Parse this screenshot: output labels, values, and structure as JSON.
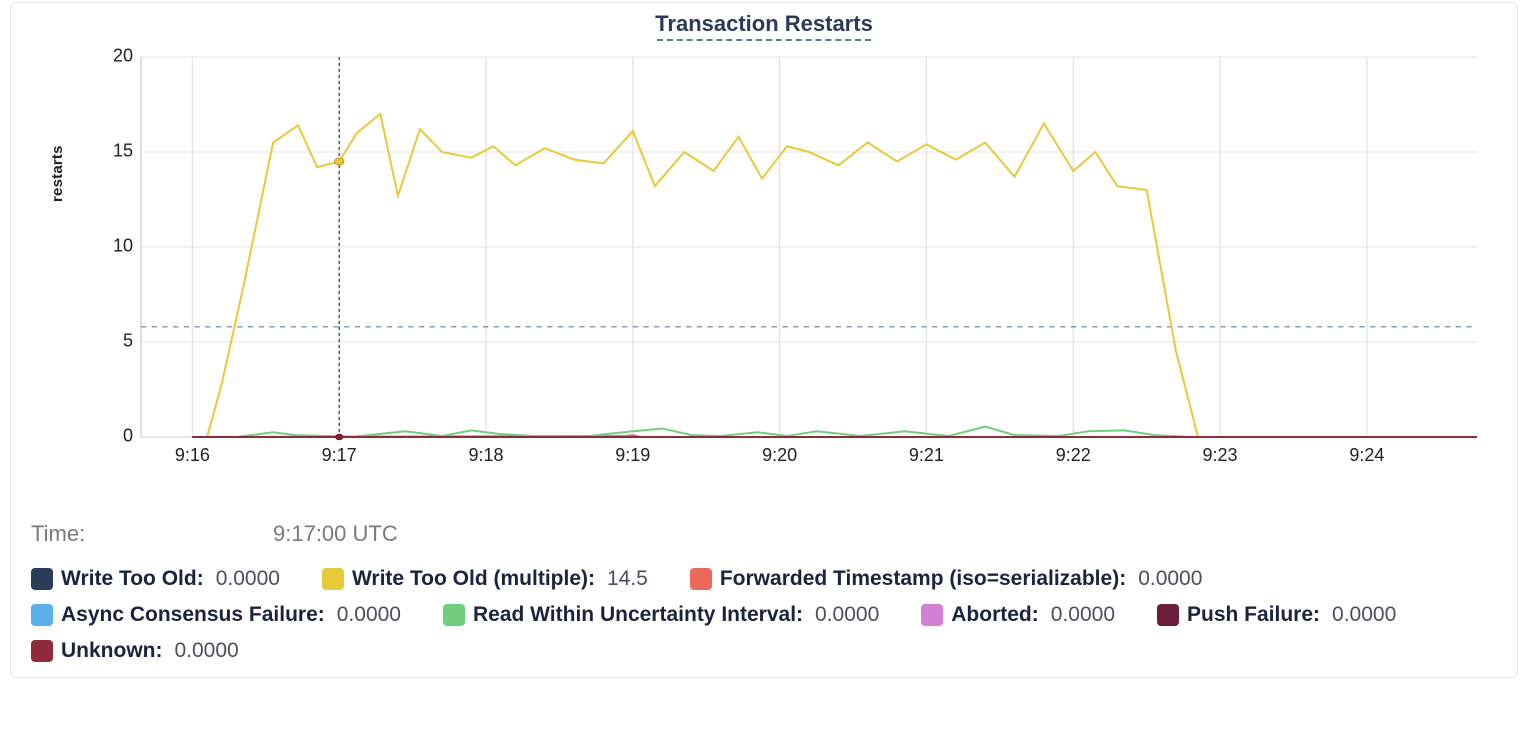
{
  "chart_data": {
    "type": "line",
    "title": "Transaction Restarts",
    "xlabel": "",
    "ylabel": "restarts",
    "ylim": [
      0,
      20
    ],
    "yticks": [
      0,
      5,
      10,
      15,
      20
    ],
    "xlim_minutes": [
      15.65,
      24.75
    ],
    "x_tick_labels": [
      "9:16",
      "9:17",
      "9:18",
      "9:19",
      "9:20",
      "9:21",
      "9:22",
      "9:23",
      "9:24"
    ],
    "x_tick_minutes": [
      16,
      17,
      18,
      19,
      20,
      21,
      22,
      23,
      24
    ],
    "reference_line": 5.8,
    "cursor_minute": 17.0,
    "series": [
      {
        "name": "Write Too Old",
        "color": "#2a3c59",
        "x": [
          16.0,
          16.1,
          16.2,
          16.3,
          20.0,
          24.75
        ],
        "y": [
          0,
          0,
          0,
          0,
          0,
          0
        ]
      },
      {
        "name": "Write Too Old (multiple)",
        "color": "#e7c93a",
        "x": [
          16.1,
          16.2,
          16.35,
          16.55,
          16.72,
          16.85,
          17.0,
          17.12,
          17.28,
          17.4,
          17.55,
          17.7,
          17.9,
          18.05,
          18.2,
          18.4,
          18.6,
          18.8,
          19.0,
          19.15,
          19.35,
          19.55,
          19.72,
          19.88,
          20.05,
          20.2,
          20.4,
          20.6,
          20.8,
          21.0,
          21.2,
          21.4,
          21.6,
          21.8,
          22.0,
          22.15,
          22.3,
          22.5,
          22.7,
          22.85
        ],
        "y": [
          0.0,
          2.8,
          8.0,
          15.5,
          16.4,
          14.2,
          14.5,
          16.0,
          17.0,
          12.7,
          16.2,
          15.0,
          14.7,
          15.3,
          14.3,
          15.2,
          14.6,
          14.4,
          16.1,
          13.2,
          15.0,
          14.0,
          15.8,
          13.6,
          15.3,
          15.0,
          14.3,
          15.5,
          14.5,
          15.4,
          14.6,
          15.5,
          13.7,
          16.5,
          14.0,
          15.0,
          13.2,
          13.0,
          4.5,
          0.0
        ]
      },
      {
        "name": "Forwarded Timestamp (iso=serializable)",
        "color": "#ed6a5a",
        "x": [
          16.0,
          18.95,
          19.0,
          19.05,
          24.75
        ],
        "y": [
          0,
          0.05,
          0.1,
          0,
          0
        ]
      },
      {
        "name": "Async Consensus Failure",
        "color": "#5ab0e8",
        "x": [
          16.0,
          24.75
        ],
        "y": [
          0,
          0
        ]
      },
      {
        "name": "Read Within Uncertainty Interval",
        "color": "#6fcf7f",
        "x": [
          16.3,
          16.55,
          16.7,
          16.9,
          17.1,
          17.45,
          17.7,
          17.9,
          18.1,
          18.4,
          18.7,
          19.0,
          19.2,
          19.4,
          19.6,
          19.85,
          20.05,
          20.25,
          20.55,
          20.85,
          21.15,
          21.4,
          21.6,
          21.9,
          22.1,
          22.35,
          22.55,
          22.8
        ],
        "y": [
          0.0,
          0.25,
          0.1,
          0.05,
          0.02,
          0.3,
          0.05,
          0.35,
          0.15,
          0.02,
          0.05,
          0.3,
          0.45,
          0.1,
          0.05,
          0.25,
          0.05,
          0.3,
          0.05,
          0.3,
          0.05,
          0.55,
          0.1,
          0.05,
          0.3,
          0.35,
          0.1,
          0.0
        ]
      },
      {
        "name": "Aborted",
        "color": "#d37fd3",
        "x": [
          16.0,
          24.75
        ],
        "y": [
          0,
          0
        ]
      },
      {
        "name": "Push Failure",
        "color": "#6b1f3a",
        "x": [
          16.0,
          24.75
        ],
        "y": [
          0,
          0
        ]
      },
      {
        "name": "Unknown",
        "color": "#8f2b3a",
        "x": [
          16.0,
          24.75
        ],
        "y": [
          0,
          0
        ]
      }
    ]
  },
  "tooltip": {
    "time_label": "Time:",
    "time_value": "9:17:00 UTC",
    "items": [
      {
        "name": "Write Too Old",
        "value": "0.0000",
        "color": "#2a3c59"
      },
      {
        "name": "Write Too Old (multiple)",
        "value": "14.5",
        "color": "#e7c93a"
      },
      {
        "name": "Forwarded Timestamp (iso=serializable)",
        "value": "0.0000",
        "color": "#ed6a5a"
      },
      {
        "name": "Async Consensus Failure",
        "value": "0.0000",
        "color": "#5ab0e8"
      },
      {
        "name": "Read Within Uncertainty Interval",
        "value": "0.0000",
        "color": "#6fcf7f"
      },
      {
        "name": "Aborted",
        "value": "0.0000",
        "color": "#d37fd3"
      },
      {
        "name": "Push Failure",
        "value": "0.0000",
        "color": "#6b1f3a"
      },
      {
        "name": "Unknown",
        "value": "0.0000",
        "color": "#8f2b3a"
      }
    ],
    "rows": [
      [
        0,
        1,
        2
      ],
      [
        3,
        4,
        5,
        6
      ],
      [
        7
      ]
    ]
  }
}
